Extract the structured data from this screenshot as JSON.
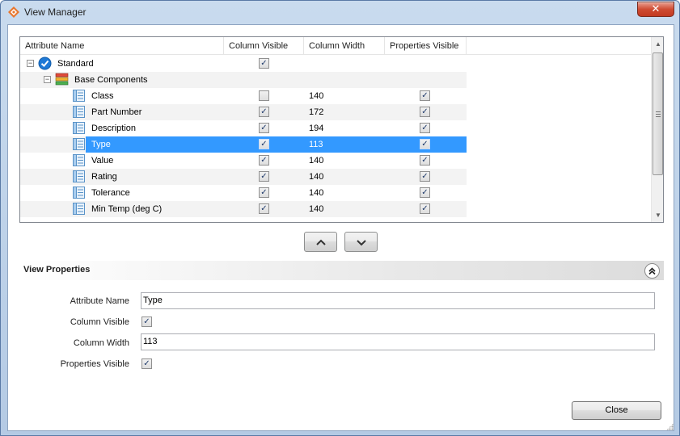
{
  "window": {
    "title": "View Manager",
    "close_glyph": "✕"
  },
  "grid": {
    "columns": [
      "Attribute Name",
      "Column Visible",
      "Column Width",
      "Properties Visible"
    ],
    "rows": [
      {
        "level": 0,
        "expander": "−",
        "icon": "check-circle-icon",
        "name": "Standard",
        "col_visible": true,
        "width": "",
        "props_visible": null
      },
      {
        "level": 1,
        "expander": "−",
        "icon": "stack-icon",
        "name": "Base Components",
        "col_visible": null,
        "width": "",
        "props_visible": null
      },
      {
        "level": 2,
        "icon": "attribute-icon",
        "name": "Class",
        "col_visible": false,
        "width": "140",
        "props_visible": true
      },
      {
        "level": 2,
        "icon": "attribute-icon",
        "name": "Part Number",
        "col_visible": true,
        "width": "172",
        "props_visible": true
      },
      {
        "level": 2,
        "icon": "attribute-icon",
        "name": "Description",
        "col_visible": true,
        "width": "194",
        "props_visible": true
      },
      {
        "level": 2,
        "icon": "attribute-icon",
        "name": "Type",
        "col_visible": true,
        "width": "113",
        "props_visible": true,
        "selected": true
      },
      {
        "level": 2,
        "icon": "attribute-icon",
        "name": "Value",
        "col_visible": true,
        "width": "140",
        "props_visible": true
      },
      {
        "level": 2,
        "icon": "attribute-icon",
        "name": "Rating",
        "col_visible": true,
        "width": "140",
        "props_visible": true
      },
      {
        "level": 2,
        "icon": "attribute-icon",
        "name": "Tolerance",
        "col_visible": true,
        "width": "140",
        "props_visible": true
      },
      {
        "level": 2,
        "icon": "attribute-icon",
        "name": "Min Temp (deg C)",
        "col_visible": true,
        "width": "140",
        "props_visible": true
      }
    ],
    "check_glyph": "✓"
  },
  "move_buttons": {
    "up_glyph": "︿",
    "down_glyph": "﹀"
  },
  "properties": {
    "title": "View Properties",
    "collapse_glyph": "≪",
    "attribute_name_label": "Attribute Name",
    "attribute_name_value": "Type",
    "column_visible_label": "Column Visible",
    "column_visible": true,
    "column_width_label": "Column Width",
    "column_width_value": "113",
    "properties_visible_label": "Properties Visible",
    "properties_visible": true
  },
  "footer": {
    "close_label": "Close"
  },
  "colors": {
    "selection": "#3399ff",
    "title_close": "#cf4b32"
  }
}
